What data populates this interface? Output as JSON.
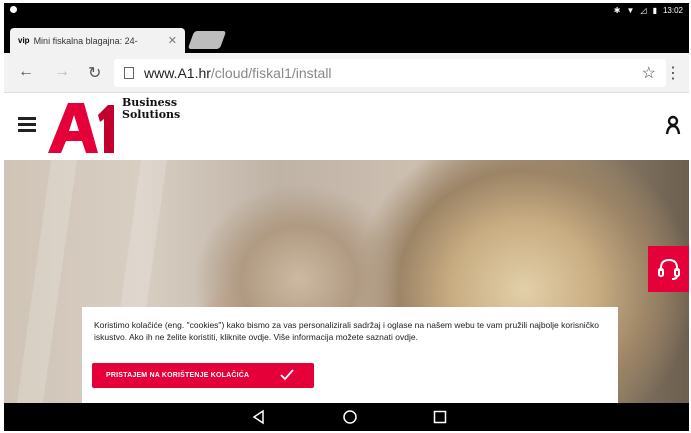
{
  "statusbar": {
    "time": "13:02"
  },
  "browser": {
    "tab_title": "Mini fiskalna blagajna: 24-",
    "tab_favicon": "vip",
    "url_host": "www.A1.hr",
    "url_path": "/cloud/fiskal1/install"
  },
  "site": {
    "brand_line1": "Business",
    "brand_line2": "Solutions",
    "accent": "#e5003a"
  },
  "cookie": {
    "text": "Koristimo kolačiće (eng. \"cookies\") kako bismo za vas personalizirali sadržaj i oglase na našem webu te vam pružili najbolje korisničko iskustvo. Ako ih ne želite koristiti, kliknite ovdje. Više informacija možete saznati ovdje.",
    "button_label": "PRISTAJEM NA KORIŠTENJE KOLAČIĆA"
  },
  "icons": {
    "hamburger": "hamburger-menu-icon",
    "user": "user-icon",
    "support": "headset-icon",
    "back": "back-icon",
    "home": "home-icon",
    "recents": "recents-icon"
  }
}
